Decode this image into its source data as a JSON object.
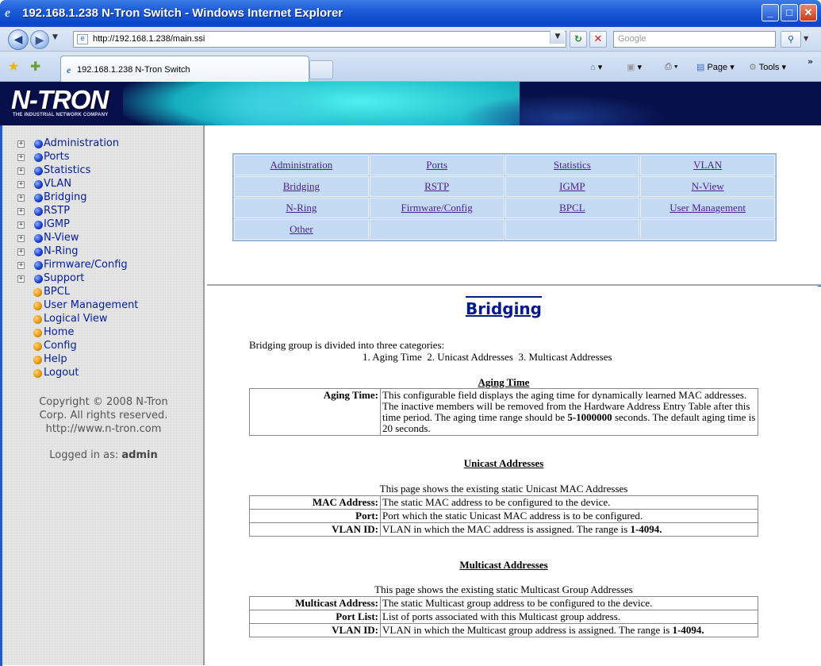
{
  "window": {
    "title": "192.168.1.238 N-Tron Switch - Windows Internet Explorer",
    "minimize": "_",
    "maximize": "□",
    "close": "✕"
  },
  "addressbar": {
    "url": "http://192.168.1.238/main.ssi",
    "search_placeholder": "Google"
  },
  "toolbar": {
    "tab_label": "192.168.1.238 N-Tron Switch",
    "page_label": "Page",
    "tools_label": "Tools"
  },
  "banner": {
    "logo": "N-TRON",
    "tagline": "THE INDUSTRIAL NETWORK COMPANY"
  },
  "sidebar": {
    "expandable": [
      {
        "label": "Administration"
      },
      {
        "label": "Ports"
      },
      {
        "label": "Statistics"
      },
      {
        "label": "VLAN"
      },
      {
        "label": "Bridging"
      },
      {
        "label": "RSTP"
      },
      {
        "label": "IGMP"
      },
      {
        "label": "N-View"
      },
      {
        "label": "N-Ring"
      },
      {
        "label": "Firmware/Config"
      },
      {
        "label": "Support"
      }
    ],
    "leaves": [
      {
        "label": "BPCL"
      },
      {
        "label": "User Management"
      },
      {
        "label": "Logical View"
      },
      {
        "label": "Home"
      },
      {
        "label": "Config"
      },
      {
        "label": "Help"
      },
      {
        "label": "Logout"
      }
    ],
    "copyright_line1": "Copyright © 2008 N-Tron",
    "copyright_line2": "Corp. All rights reserved.",
    "copyright_line3": "http://www.n-tron.com",
    "logged_in_prefix": "Logged in as:",
    "logged_in_user": "admin"
  },
  "menu": {
    "rows": [
      [
        "Administration",
        "Ports",
        "Statistics",
        "VLAN"
      ],
      [
        "Bridging",
        "RSTP",
        "IGMP",
        "N-View"
      ],
      [
        "N-Ring",
        "Firmware/Config",
        "BPCL",
        "User Management"
      ],
      [
        "Other",
        "",
        "",
        ""
      ]
    ]
  },
  "content": {
    "heading": "Bridging",
    "intro": "Bridging group is divided into three categories:",
    "categories": "1. Aging Time  2. Unicast Addresses  3. Multicast Addresses",
    "aging": {
      "heading": "Aging Time",
      "rows": [
        {
          "key": "Aging Time:",
          "value_before": "This configurable field displays the aging time for dynamically learned MAC addresses. The inactive members will be removed from the Hardware Address Entry Table after this time period. The aging time range should be ",
          "value_bold": "5-1000000",
          "value_after": " seconds. The default aging time is 20 seconds."
        }
      ]
    },
    "unicast": {
      "heading": "Unicast Addresses",
      "note": "This page shows the existing static Unicast MAC Addresses",
      "rows": [
        {
          "key": "MAC Address:",
          "value": "The static MAC address to be configured to the device."
        },
        {
          "key": "Port:",
          "value": "Port which the static Unicast MAC address is to be configured."
        },
        {
          "key": "VLAN ID:",
          "value_before": "VLAN in which the MAC address is assigned. The range is ",
          "value_bold": "1-4094."
        }
      ]
    },
    "multicast": {
      "heading": "Multicast Addresses",
      "note": "This page shows the existing static Multicast Group Addresses",
      "rows": [
        {
          "key": "Multicast Address:",
          "value": "The static Multicast group address to be configured to the device."
        },
        {
          "key": "Port List:",
          "value": "List of ports associated with this Multicast group address."
        },
        {
          "key": "VLAN ID:",
          "value_before": "VLAN in which the Multicast group address is assigned. The range is ",
          "value_bold": "1-4094."
        }
      ]
    }
  }
}
